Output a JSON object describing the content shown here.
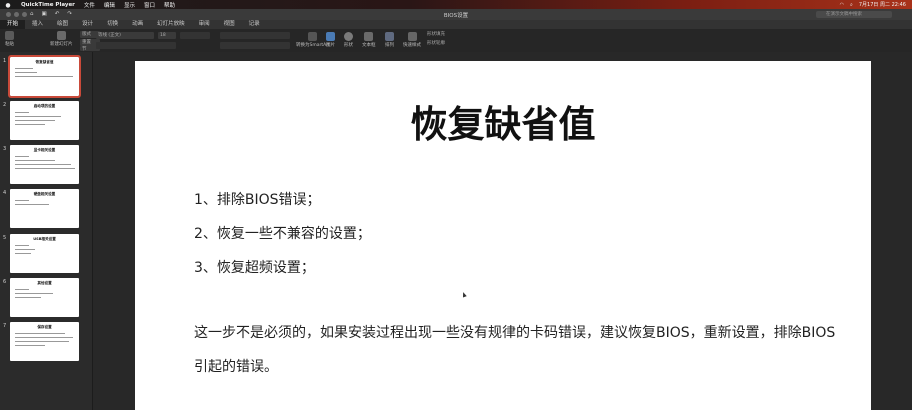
{
  "menubar": {
    "app": "QuickTime Player",
    "items": [
      "文件",
      "编辑",
      "显示",
      "窗口",
      "帮助"
    ],
    "datetime": "7月17日 周二 22:46"
  },
  "window": {
    "title": "BIOS设置",
    "search_placeholder": "在演示文稿中搜索"
  },
  "tabs": [
    "开始",
    "插入",
    "绘图",
    "设计",
    "切换",
    "动画",
    "幻灯片放映",
    "审阅",
    "视图",
    "记录"
  ],
  "ribbon": {
    "paste": "粘贴",
    "new_slide": "新建幻灯片",
    "layout": "版式",
    "reset": "重置",
    "section": "节",
    "font_name": "等线 (正文)",
    "font_size": "18",
    "convert_smartart": "转换为SmartArt",
    "picture": "图片",
    "shape": "形状",
    "textbox": "文本框",
    "arrange": "排列",
    "quick_styles": "快速样式",
    "shape_fill": "形状填充",
    "shape_outline": "形状轮廓"
  },
  "thumbnails": [
    {
      "num": "1",
      "title": "恢复缺省值"
    },
    {
      "num": "2",
      "title": "启动项的设置"
    },
    {
      "num": "3",
      "title": "显卡相关设置"
    },
    {
      "num": "4",
      "title": "硬盘相关设置"
    },
    {
      "num": "5",
      "title": "USB相关设置"
    },
    {
      "num": "6",
      "title": "其他设置"
    },
    {
      "num": "7",
      "title": "保存设置"
    }
  ],
  "slide": {
    "title": "恢复缺省值",
    "items": [
      "1、排除BIOS错误；",
      "2、恢复一些不兼容的设置；",
      "3、恢复超频设置；"
    ],
    "paragraph_line1": "这一步不是必须的，如果安装过程出现一些没有规律的卡码错误，建议恢复BIOS，重新设置，排除BIOS",
    "paragraph_line2": "引起的错误。"
  },
  "colors": {
    "accent": "#c94a3a",
    "selected_tab": "#1f1f1f",
    "slide_bg": "#ffffff"
  }
}
